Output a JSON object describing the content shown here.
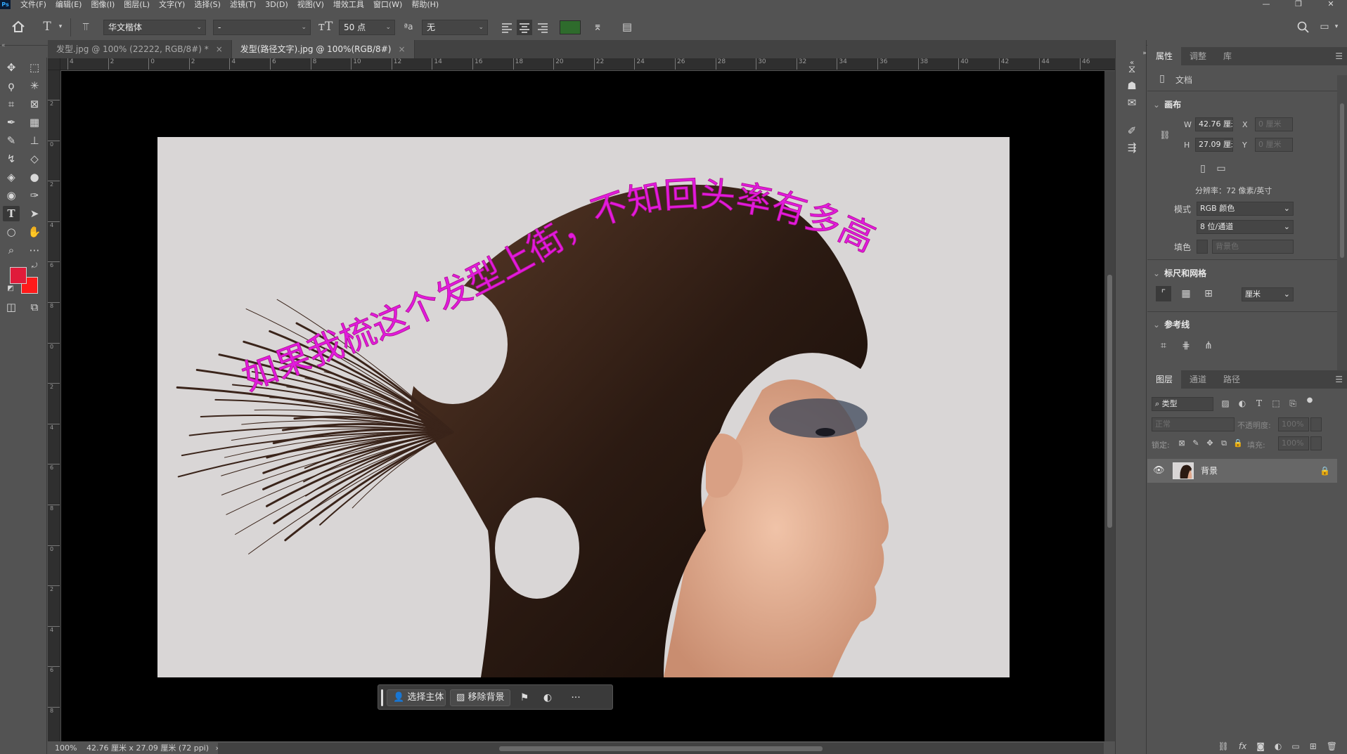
{
  "app": {
    "logo": "Ps"
  },
  "menu": [
    "文件(F)",
    "编辑(E)",
    "图像(I)",
    "图层(L)",
    "文字(Y)",
    "选择(S)",
    "滤镜(T)",
    "3D(D)",
    "视图(V)",
    "增效工具",
    "窗口(W)",
    "帮助(H)"
  ],
  "window_controls": {
    "minimize": "—",
    "restore": "❐",
    "close": "✕"
  },
  "options_bar": {
    "font_family": "华文楷体",
    "font_style": "-",
    "font_size": "50 点",
    "anti_alias_icon": "ªa",
    "anti_alias": "无",
    "text_color": "#2e6b2c"
  },
  "tools": {
    "foreground_color": "#e01b3a",
    "background_color": "#ff1a1a"
  },
  "tabs": [
    {
      "label": "发型.jpg @ 100% (22222, RGB/8#) *",
      "close": "×"
    },
    {
      "label": "发型(路径文字).jpg @ 100%(RGB/8#)",
      "close": "×"
    }
  ],
  "ruler_h": [
    "4",
    "2",
    "0",
    "2",
    "4",
    "6",
    "8",
    "10",
    "12",
    "14",
    "16",
    "18",
    "20",
    "22",
    "24",
    "26",
    "28",
    "30",
    "32",
    "34",
    "36",
    "38",
    "40",
    "42",
    "44",
    "46"
  ],
  "ruler_v": [
    "2",
    "0",
    "2",
    "4",
    "6",
    "8",
    "0",
    "2",
    "4",
    "6",
    "8",
    "0",
    "2",
    "4",
    "6",
    "8",
    "0"
  ],
  "canvas": {
    "path_text": "如果我梳这个发型上街，不知回头率有多高",
    "text_color": "#e01bdc",
    "photo_background": "#d9d6d6",
    "hair_color": "#2b1a12",
    "skin_color": "#e8b59a"
  },
  "taskbar": {
    "select_subject": "选择主体",
    "remove_bg": "移除背景",
    "more": "···"
  },
  "status": {
    "zoom": "100%",
    "doc_size": "42.76 厘米 x 27.09 厘米 (72 ppi)",
    "arrow": "›"
  },
  "right_panel": {
    "props_tabs": [
      "属性",
      "调整",
      "库"
    ],
    "doc_label": "文档",
    "canvas_section": "画布",
    "w_label": "W",
    "w_value": "42.76 厘米",
    "h_label": "H",
    "h_value": "27.09 厘米",
    "x_label": "X",
    "x_value": "0 厘米",
    "y_label": "Y",
    "y_value": "0 厘米",
    "resolution": "分辨率：72 像素/英寸",
    "mode_label": "模式",
    "mode_value": "RGB 颜色",
    "depth_value": "8 位/通道",
    "fill_label": "填色",
    "fill_value": "背景色",
    "rulers_section": "标尺和网格",
    "unit_value": "厘米",
    "guides_section": "参考线",
    "layers_tabs": [
      "图层",
      "通道",
      "路径"
    ],
    "filter_placeholder": "类型",
    "blend_mode": "正常",
    "opacity_label": "不透明度:",
    "opacity_value": "100%",
    "lock_label": "锁定:",
    "fill_opacity_label": "填充:",
    "fill_opacity_value": "100%",
    "layer_name": "背景"
  }
}
